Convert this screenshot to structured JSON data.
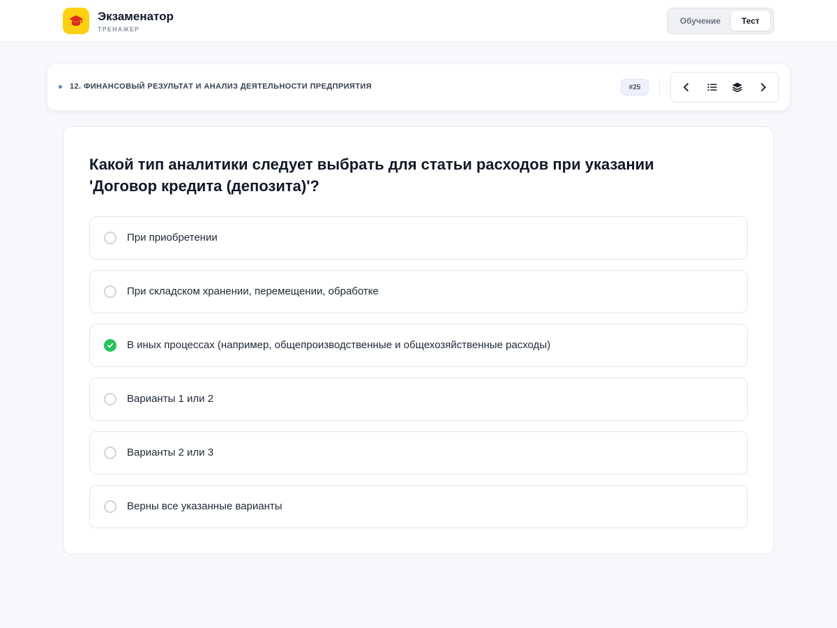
{
  "brand": {
    "title": "Экзаменатор",
    "subtitle": "ТРЕНАЖЕР",
    "logo_icon": "graduation-cap-icon",
    "logo_color": "#ffcf14"
  },
  "mode_switch": {
    "learn_label": "Обучение",
    "test_label": "Тест",
    "active": "Тест"
  },
  "topic": {
    "title": "12. ФИНАНСОВЫЙ РЕЗУЛЬТАТ И АНАЛИЗ ДЕЯТЕЛЬНОСТИ ПРЕДПРИЯТИЯ",
    "question_number": "#25"
  },
  "navigation": {
    "buttons": [
      "chevron-left-icon",
      "list-icon",
      "layers-icon",
      "chevron-right-icon"
    ]
  },
  "question": {
    "text": "Какой тип аналитики следует выбрать для статьи расходов при указании 'Договор кредита (депозита)'?",
    "options": [
      {
        "label": "При приобретении",
        "selected": false
      },
      {
        "label": "При складском хранении, перемещении, обработке",
        "selected": false
      },
      {
        "label": "В иных процессах (например, общепроизводственные и общехозяйственные расходы)",
        "selected": true
      },
      {
        "label": "Варианты 1 или 2",
        "selected": false
      },
      {
        "label": "Варианты 2 или 3",
        "selected": false
      },
      {
        "label": "Верны все указанные варианты",
        "selected": false
      }
    ]
  },
  "colors": {
    "accent_correct": "#22c55e",
    "background": "#f7f8fb",
    "topic_dot": "#6b7fd6"
  }
}
